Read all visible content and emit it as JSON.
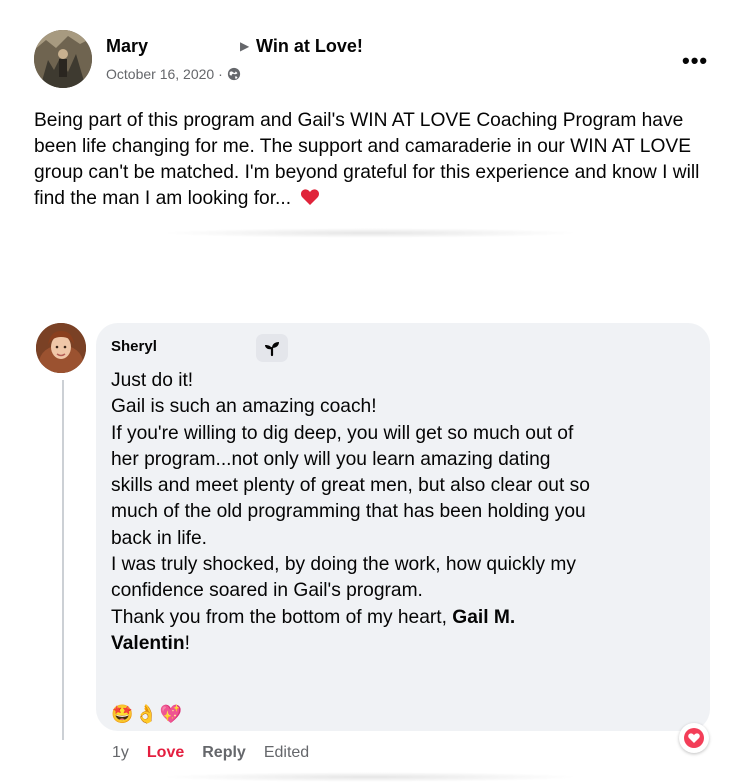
{
  "post": {
    "author": "Mary",
    "group": "Win at Love!",
    "date": "October 16, 2020 ·",
    "more_label": "•••",
    "text": "Being part of this program and Gail's WIN AT LOVE Coaching Program have been life changing for me. The support and camaraderie in our WIN AT LOVE group can't be matched. I'm beyond grateful for this experience and know I will find the man I am looking for...",
    "icons": {
      "privacy": "globe-icon",
      "more": "more-icon",
      "emoji": "red-heart-emoji"
    }
  },
  "comment": {
    "author": "Sheryl",
    "lines": [
      "Just do it!",
      "Gail is such an amazing coach!",
      "If you're willing to dig deep, you will get so much out of",
      "her program...not only will you learn amazing dating",
      "skills and meet plenty of great men, but also clear out so",
      "much of the old programming that has been holding you",
      "back in life.",
      "I was truly shocked, by doing the work, how quickly my",
      "confidence soared in Gail's program.",
      "Thank you from the bottom of my heart,"
    ],
    "mention_part1": "Gail M.",
    "mention_part2": "Valentin",
    "mention_suffix": "!",
    "emojis": [
      "🤩",
      "👌",
      "💖"
    ],
    "badge_icon": "new-member-sprout-icon",
    "actions": {
      "time": "1y",
      "love": "Love",
      "reply": "Reply",
      "edited": "Edited"
    },
    "reaction_icon": "love-reaction-icon"
  },
  "colors": {
    "love": "#e41e3f",
    "bubble": "#f0f2f5",
    "secondary_text": "#65676b"
  }
}
